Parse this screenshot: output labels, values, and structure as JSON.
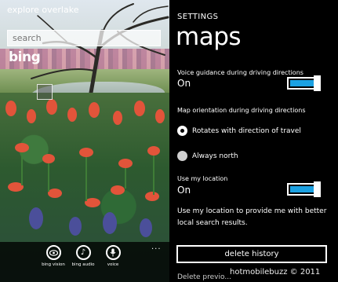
{
  "left_screen": {
    "app_title": "explore overlake",
    "search": {
      "placeholder": "search"
    },
    "logo_text": "bing",
    "appbar": {
      "buttons": [
        {
          "label": "bing vision",
          "icon": "eye-icon"
        },
        {
          "label": "bing audio",
          "icon": "music-note-icon"
        },
        {
          "label": "voice",
          "icon": "microphone-icon"
        }
      ],
      "more": "..."
    }
  },
  "right_screen": {
    "kicker": "SETTINGS",
    "title": "maps",
    "voice_guidance": {
      "label": "Voice guidance during driving directions",
      "value": "On",
      "on": true
    },
    "map_orientation": {
      "label": "Map orientation during driving directions",
      "options": [
        {
          "label": "Rotates with direction of travel",
          "selected": true
        },
        {
          "label": "Always north",
          "selected": false
        }
      ]
    },
    "use_location": {
      "label": "Use my location",
      "value": "On",
      "on": true
    },
    "location_description": "Use my location to provide me with better local search results.",
    "delete_history_label": "delete history",
    "cutoff_text": "Delete previo..."
  },
  "watermark": "hotmobilebuzz © 2011",
  "colors": {
    "accent": "#1ba1e2",
    "background": "#000000",
    "foreground": "#ffffff"
  }
}
